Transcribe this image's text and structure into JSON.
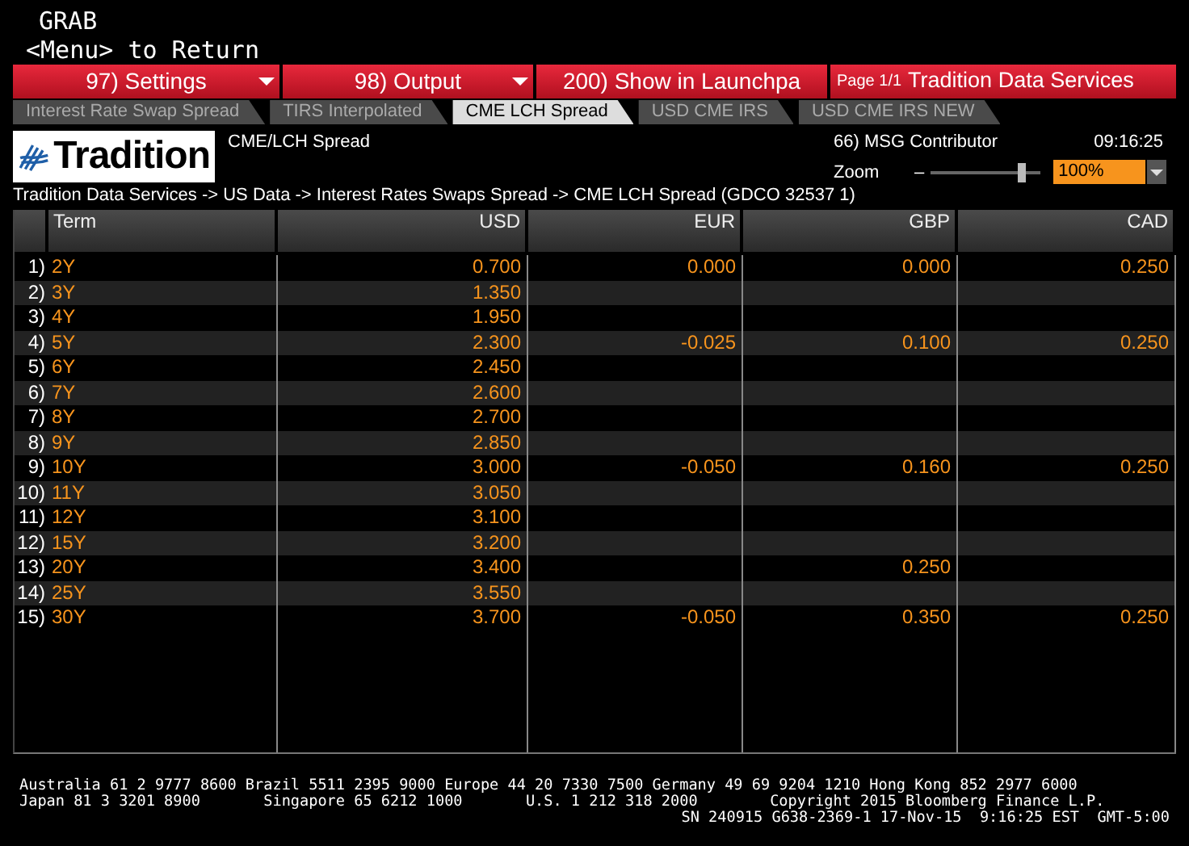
{
  "header": {
    "title": "GRAB",
    "subtitle": "<Menu> to Return"
  },
  "toolbar": {
    "buttons": [
      {
        "number": "97)",
        "label": "Settings",
        "dropdown": true
      },
      {
        "number": "98)",
        "label": "Output",
        "dropdown": true
      },
      {
        "number": "200)",
        "label": "Show in Launchpa",
        "dropdown": false
      }
    ],
    "page": "Page 1/1",
    "source": "Tradition Data Services"
  },
  "tabs": [
    {
      "label": "Interest Rate Swap Spread",
      "selected": false
    },
    {
      "label": "TIRS Interpolated",
      "selected": false
    },
    {
      "label": "CME LCH Spread",
      "selected": true
    },
    {
      "label": "USD CME IRS",
      "selected": false
    },
    {
      "label": "USD CME IRS NEW",
      "selected": false
    }
  ],
  "panel": {
    "logo": "Tradition",
    "title": "CME/LCH Spread",
    "contributor_number": "66)",
    "contributor": "MSG Contributor",
    "time": "09:16:25",
    "zoom_label": "Zoom",
    "zoom_minus": "–",
    "zoom": {
      "level": 0.82
    },
    "zoom_value": "100%",
    "breadcrumb": "Tradition Data Services -> US Data -> Interest Rates Swaps Spread -> CME LCH Spread (GDCO 32537 1)"
  },
  "table": {
    "columns": [
      "Term",
      "USD",
      "EUR",
      "GBP",
      "CAD"
    ],
    "rows": [
      {
        "number": "1)",
        "term": "2Y",
        "usd": "0.700",
        "eur": "0.000",
        "gbp": "0.000",
        "cad": "0.250"
      },
      {
        "number": "2)",
        "term": "3Y",
        "usd": "1.350"
      },
      {
        "number": "3)",
        "term": "4Y",
        "usd": "1.950"
      },
      {
        "number": "4)",
        "term": "5Y",
        "usd": "2.300",
        "eur": "-0.025",
        "gbp": "0.100",
        "cad": "0.250"
      },
      {
        "number": "5)",
        "term": "6Y",
        "usd": "2.450"
      },
      {
        "number": "6)",
        "term": "7Y",
        "usd": "2.600"
      },
      {
        "number": "7)",
        "term": "8Y",
        "usd": "2.700"
      },
      {
        "number": "8)",
        "term": "9Y",
        "usd": "2.850"
      },
      {
        "number": "9)",
        "term": "10Y",
        "usd": "3.000",
        "eur": "-0.050",
        "gbp": "0.160",
        "cad": "0.250"
      },
      {
        "number": "10)",
        "term": "11Y",
        "usd": "3.050"
      },
      {
        "number": "11)",
        "term": "12Y",
        "usd": "3.100"
      },
      {
        "number": "12)",
        "term": "15Y",
        "usd": "3.200"
      },
      {
        "number": "13)",
        "term": "20Y",
        "usd": "3.400",
        "gbp": "0.250"
      },
      {
        "number": "14)",
        "term": "25Y",
        "usd": "3.550"
      },
      {
        "number": "15)",
        "term": "30Y",
        "usd": "3.700",
        "eur": "-0.050",
        "gbp": "0.350",
        "cad": "0.250"
      }
    ]
  },
  "footer": [
    "Australia 61 2 9777 8600 Brazil 5511 2395 9000 Europe 44 20 7330 7500 Germany 49 69 9204 1210 Hong Kong 852 2977 6000",
    "Japan 81 3 3201 8900       Singapore 65 6212 1000       U.S. 1 212 318 2000        Copyright 2015 Bloomberg Finance L.P.",
    "SN 240915 G638-2369-1 17-Nov-15  9:16:25 EST  GMT-5:00"
  ]
}
